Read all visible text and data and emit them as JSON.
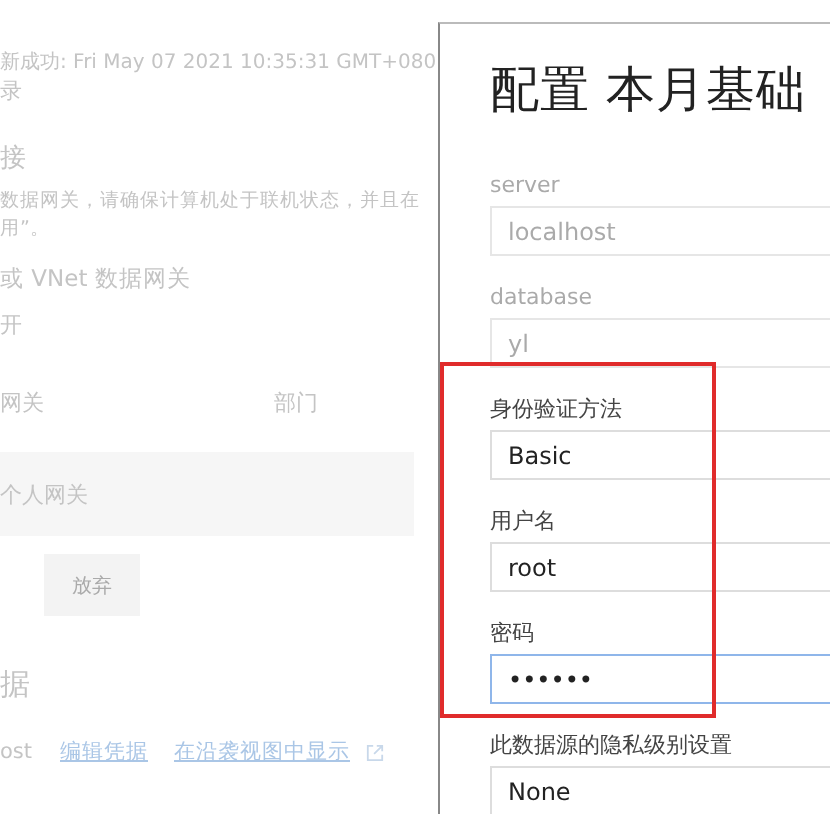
{
  "page": {
    "refresh_status": "新成功: Fri May 07 2021 10:35:31 GMT+080",
    "history_link": "录",
    "connection": {
      "heading": "接",
      "note_lines": [
        "数据网关，请确保计算机处于联机状态，并且在",
        "用”。"
      ]
    },
    "gateway_toggle": {
      "label": "或 VNet 数据网关",
      "state_label": "开"
    },
    "table": {
      "columns": [
        "网关",
        "部门"
      ],
      "rows": [
        [
          "个人网关"
        ]
      ]
    },
    "buttons": [
      {
        "label": "放弃",
        "disabled": true
      }
    ],
    "credentials": {
      "heading": "据",
      "source": "ost",
      "links": [
        "编辑凭据",
        "在沿袭视图中显示"
      ]
    }
  },
  "dialog": {
    "title": "配置 本月基础",
    "fields": [
      {
        "label": "server",
        "value": "localhost",
        "disabled": true,
        "focused": false,
        "highlighted": false
      },
      {
        "label": "database",
        "value": "yl",
        "disabled": true,
        "focused": false,
        "highlighted": false
      },
      {
        "label": "身份验证方法",
        "value": "Basic",
        "disabled": false,
        "focused": false,
        "highlighted": true
      },
      {
        "label": "用户名",
        "value": "root",
        "disabled": false,
        "focused": false,
        "highlighted": true
      },
      {
        "label": "密码",
        "value": "••••••",
        "disabled": false,
        "focused": true,
        "highlighted": true
      },
      {
        "label": "此数据源的隐私级别设置",
        "value": "None",
        "disabled": false,
        "focused": false,
        "highlighted": false
      }
    ]
  }
}
